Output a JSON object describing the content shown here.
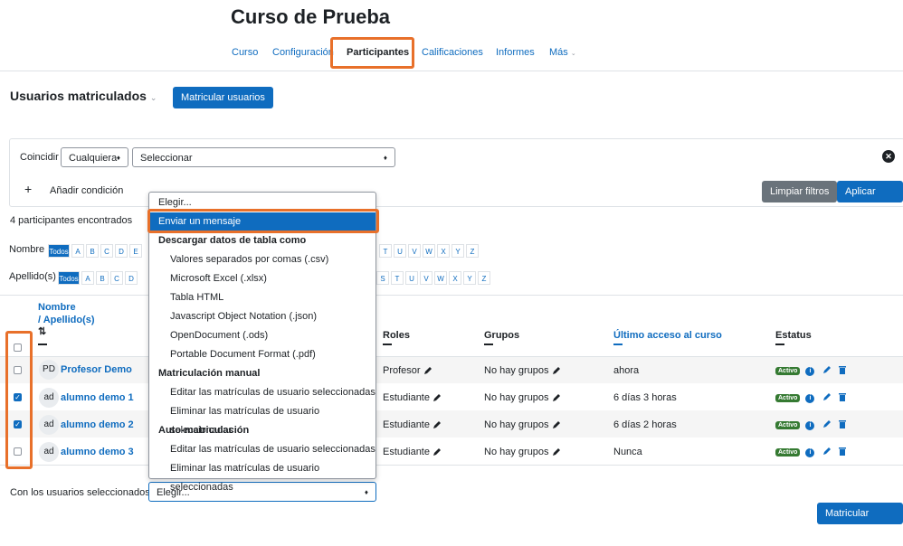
{
  "course_title": "Curso de Prueba",
  "nav": {
    "curso": "Curso",
    "configuracion": "Configuración",
    "participantes": "Participantes",
    "calificaciones": "Calificaciones",
    "informes": "Informes",
    "mas": "Más"
  },
  "enrolled": {
    "heading": "Usuarios matriculados",
    "enrol_button": "Matricular usuarios"
  },
  "filter": {
    "match_label": "Coincidir",
    "match_value": "Cualquiera",
    "select_value": "Seleccionar",
    "add_condition": "Añadir condición",
    "clear_button": "Limpiar filtros",
    "apply_button": "Aplicar filtros"
  },
  "found_text": "4 participantes encontrados",
  "initials": {
    "first_label": "Nombre",
    "last_label": "Apellido(s)",
    "all_label": "Todos",
    "letters_left": [
      "A",
      "B",
      "C",
      "D",
      "E"
    ],
    "letters_left_last": [
      "A",
      "B",
      "C",
      "D"
    ],
    "letters_right_first": [
      "T",
      "U",
      "V",
      "W",
      "X",
      "Y",
      "Z"
    ],
    "letters_right_last": [
      "S",
      "T",
      "U",
      "V",
      "W",
      "X",
      "Y",
      "Z"
    ]
  },
  "table": {
    "col_name": "Nombre",
    "col_lastname": "/ Apellido(s)",
    "col_roles": "Roles",
    "col_groups": "Grupos",
    "col_access": "Último acceso al curso",
    "col_status": "Estatus",
    "rows": [
      {
        "initials": "PD",
        "name": "Profesor Demo",
        "role": "Profesor",
        "groups": "No hay grupos",
        "access": "ahora",
        "status": "Activo",
        "checked": false
      },
      {
        "initials": "ad",
        "name": "alumno demo 1",
        "role": "Estudiante",
        "groups": "No hay grupos",
        "access": "6 días 3 horas",
        "status": "Activo",
        "checked": true
      },
      {
        "initials": "ad",
        "name": "alumno demo 2",
        "role": "Estudiante",
        "groups": "No hay grupos",
        "access": "6 días 2 horas",
        "status": "Activo",
        "checked": true
      },
      {
        "initials": "ad",
        "name": "alumno demo 3",
        "role": "Estudiante",
        "groups": "No hay grupos",
        "access": "Nunca",
        "status": "Activo",
        "checked": false
      }
    ]
  },
  "bulk": {
    "label": "Con los usuarios seleccionados...",
    "select_value": "Elegir...",
    "enrol_button_bottom": "Matricular usuarios"
  },
  "menu": {
    "choose": "Elegir...",
    "send_message": "Enviar un mensaje",
    "group_download": "Descargar datos de tabla como",
    "csv": "Valores separados por comas (.csv)",
    "xlsx": "Microsoft Excel (.xlsx)",
    "html": "Tabla HTML",
    "json": "Javascript Object Notation (.json)",
    "ods": "OpenDocument (.ods)",
    "pdf": "Portable Document Format (.pdf)",
    "group_manual": "Matriculación manual",
    "manual_edit": "Editar las matrículas de usuario seleccionadas",
    "manual_delete": "Eliminar las matrículas de usuario seleccionadas",
    "group_self": "Auto-matriculación",
    "self_edit": "Editar las matrículas de usuario seleccionadas",
    "self_delete": "Eliminar las matrículas de usuario seleccionadas"
  },
  "colors": {
    "primary": "#0f6cbf",
    "highlight": "#e8702a",
    "active_badge": "#357a32",
    "menu_selected": "#0f6cbf"
  }
}
